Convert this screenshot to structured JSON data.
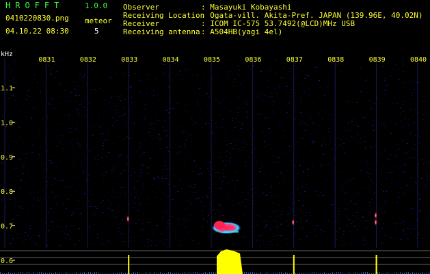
{
  "app": {
    "logo": "HROFFT",
    "version": "1.0.0"
  },
  "capture": {
    "filename": "0410220830.png",
    "datetime": "04.10.22 08:30",
    "mode_label": "meteor",
    "meteor_count": "5"
  },
  "info": {
    "rows": [
      {
        "label": "Observer",
        "value": ": Masayuki Kobayashi"
      },
      {
        "label": "Receiving Location",
        "value": ": Ogata-vill. Akita-Pref. JAPAN (139.96E, 40.02N)"
      },
      {
        "label": "Receiver",
        "value": ": ICOM IC-575 53.7492(@LCD)MHz USB"
      },
      {
        "label": "Receiving antenna",
        "value": ": A504HB(yagi 4el)"
      }
    ]
  },
  "colors": {
    "background": "#000000",
    "label_yellow": "#ffff33",
    "logo_green": "#3aff3a",
    "axis_white": "#ffffff",
    "noise_blue": "#1a1aa8",
    "echo_red": "#ff2255",
    "echo_cyan": "#33ddff",
    "power_yellow": "#ffff00"
  },
  "chart_data": {
    "type": "heatmap",
    "ylabel": "kHz",
    "x_ticks": [
      "0831",
      "0832",
      "0833",
      "0834",
      "0835",
      "0836",
      "0837",
      "0838",
      "0839",
      "0840"
    ],
    "y_ticks": [
      "1.1",
      "1.0",
      "0.9",
      "0.8",
      "0.7",
      "0.6"
    ],
    "y_values": [
      1.1,
      1.0,
      0.9,
      0.8,
      0.7,
      0.6
    ],
    "x_range_minutes": [
      830,
      840
    ],
    "y_range_khz": [
      0.58,
      1.18
    ],
    "echoes": [
      {
        "time": "0833",
        "freq_khz": 0.72,
        "strength": "weak"
      },
      {
        "time": "0835",
        "freq_khz": 0.69,
        "strength": "strong"
      },
      {
        "time": "0837",
        "freq_khz": 0.71,
        "strength": "weak"
      },
      {
        "time": "0839",
        "freq_khz": 0.71,
        "strength": "weak"
      },
      {
        "time": "0839",
        "freq_khz": 0.73,
        "strength": "weak"
      }
    ]
  }
}
